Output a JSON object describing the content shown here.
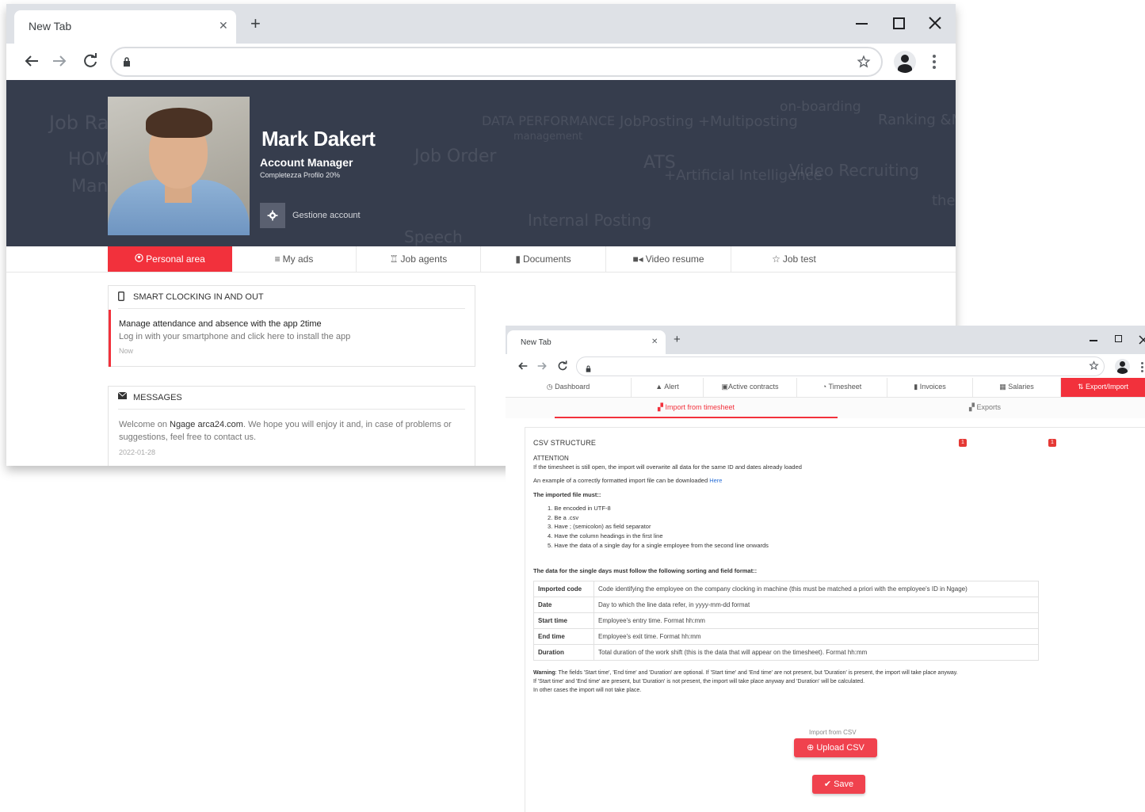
{
  "window1": {
    "tab_title": "New Tab",
    "tab_close": "✕",
    "new_tab": "+",
    "profile": {
      "name": "Mark Dakert",
      "role": "Account Manager",
      "completeness": "Completezza Profilo 20%",
      "manage_account": "Gestione account"
    },
    "banner_words": [
      "Job Rad",
      "HOM",
      "Mana",
      "Job Order",
      "DATA PERFORMANCE",
      "management",
      "JobPosting +Multiposting",
      "ATS",
      "+Artificial Intelligence",
      "Internal Posting",
      "on-boarding",
      "Ranking &Matching",
      "Video Recruiting",
      "Speech",
      "the"
    ],
    "menu": [
      {
        "label": "Personal area",
        "icon": "user-circle-icon",
        "active": true
      },
      {
        "label": "My ads",
        "icon": "list-icon",
        "active": false
      },
      {
        "label": "Job agents",
        "icon": "trophy-icon",
        "active": false
      },
      {
        "label": "Documents",
        "icon": "clipboard-icon",
        "active": false
      },
      {
        "label": "Video resume",
        "icon": "video-camera-icon",
        "active": false
      },
      {
        "label": "Job test",
        "icon": "star-icon",
        "active": false
      }
    ],
    "clocking": {
      "title": "SMART CLOCKING IN AND OUT",
      "headline": "Manage attendance and absence with the app 2time",
      "description": "Log in with your smartphone and click here to install the app",
      "time": "Now"
    },
    "messages": {
      "title": "MESSAGES",
      "text_prefix": "Welcome on ",
      "brand": "Ngage arca24.com",
      "text_suffix": ". We hope you will enjoy it and, in case of problems or",
      "text_line2": "suggestions, feel free to contact us.",
      "date": "2022-01-28"
    }
  },
  "window2": {
    "tab_title": "New Tab",
    "tab_close": "✕",
    "new_tab": "+",
    "menu": [
      {
        "label": "Dashboard",
        "icon": "dashboard-icon",
        "active": false
      },
      {
        "label": "Alert",
        "icon": "bell-icon",
        "active": false
      },
      {
        "label": "Active contracts",
        "icon": "contract-icon",
        "active": false
      },
      {
        "label": "Timesheet",
        "icon": "clock-icon",
        "active": false
      },
      {
        "label": "Invoices",
        "icon": "invoice-icon",
        "active": false,
        "badge": "1"
      },
      {
        "label": "Salaries",
        "icon": "salaries-icon",
        "active": false,
        "badge": "1"
      },
      {
        "label": "Export/Import",
        "icon": "export-import-icon",
        "active": true
      }
    ],
    "subtabs": [
      {
        "label": "Import from timesheet",
        "active": true
      },
      {
        "label": "Exports",
        "active": false
      }
    ],
    "csv": {
      "title": "CSV STRUCTURE",
      "attention": "ATTENTION",
      "attention_text": "If the timesheet is still open, the import will overwrite all data for the same ID and dates already loaded",
      "example_text": "An example of a correctly formatted import file can be downloaded ",
      "example_link": "Here",
      "must_title": "The imported file must::",
      "rules": [
        "1. Be encoded in UTF-8",
        "2. Be a .csv",
        "3. Have ; (semicolon) as field separator",
        "4. Have the column headings in the first line",
        "5. Have the data of a single day for a single employee from the second line onwards"
      ],
      "format_title": "The data for the single days must follow the following sorting and field format::",
      "fields": [
        {
          "key": "Imported code",
          "desc": "Code identifying the employee on the company clocking in machine (this must be matched a priori with the employee's ID in Ngage)"
        },
        {
          "key": "Date",
          "desc": "Day to which the line data refer, in yyyy-mm-dd format"
        },
        {
          "key": "Start time",
          "desc": "Employee's entry time. Format hh:mm"
        },
        {
          "key": "End time",
          "desc": "Employee's exit time. Format hh:mm"
        },
        {
          "key": "Duration",
          "desc": "Total duration of the work shift (this is the data that will appear on the timesheet). Format hh:mm"
        }
      ],
      "warning_label": "Warning",
      "warning_line1": ": The fields 'Start time', 'End time' and 'Duration' are optional. If 'Start time' and 'End time' are not present, but 'Duration' is present, the import will take place anyway.",
      "warning_line2": "If 'Start time' and 'End time' are present, but 'Duration' is not present, the import will take place anyway and 'Duration' will be calculated.",
      "warning_line3": "In other cases the import will not take place.",
      "import_label": "Import from CSV",
      "upload_button": "Upload CSV",
      "save_button": "Save"
    }
  },
  "colors": {
    "accent": "#f2313c",
    "banner": "#363d4d",
    "link": "#2a6fd6"
  }
}
